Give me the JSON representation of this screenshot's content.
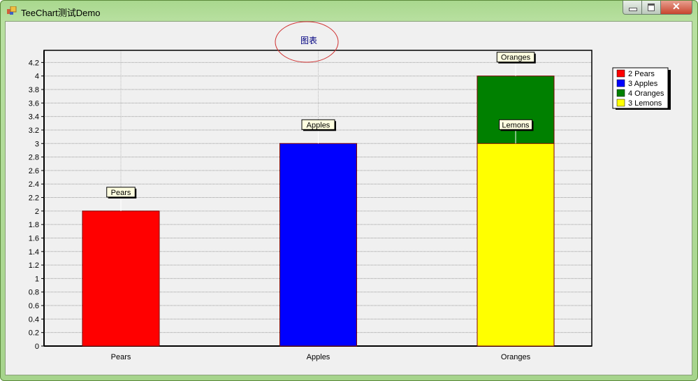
{
  "window": {
    "title": "TeeChart测试Demo",
    "icon": "app-icon",
    "buttons": [
      "minimize",
      "maximize",
      "close"
    ]
  },
  "chart_data": {
    "type": "bar",
    "title": "图表",
    "categories": [
      "Pears",
      "Apples",
      "Oranges"
    ],
    "ylim": [
      0,
      4.38
    ],
    "yticks": [
      "0",
      "0.2",
      "0.4",
      "0.6",
      "0.8",
      "1",
      "1.2",
      "1.4",
      "1.6",
      "1.8",
      "2",
      "2.2",
      "2.4",
      "2.6",
      "2.8",
      "3",
      "3.2",
      "3.4",
      "3.6",
      "3.8",
      "4",
      "4.2"
    ],
    "grid": true,
    "legend_position": "right",
    "series": [
      {
        "name": "Pears",
        "category": "Pears",
        "value": 2,
        "color": "#ff0000",
        "legend": "2 Pears",
        "mark": "Pears"
      },
      {
        "name": "Apples",
        "category": "Apples",
        "value": 3,
        "color": "#0000ff",
        "legend": "3 Apples",
        "mark": "Apples"
      },
      {
        "name": "Oranges",
        "category": "Oranges",
        "value": 4,
        "color": "#008000",
        "legend": "4 Oranges",
        "mark": "Oranges"
      },
      {
        "name": "Lemons",
        "category": "Oranges",
        "value": 3,
        "color": "#ffff00",
        "legend": "3 Lemons",
        "mark": "Lemons"
      }
    ],
    "annotation": "red ellipse around title"
  }
}
